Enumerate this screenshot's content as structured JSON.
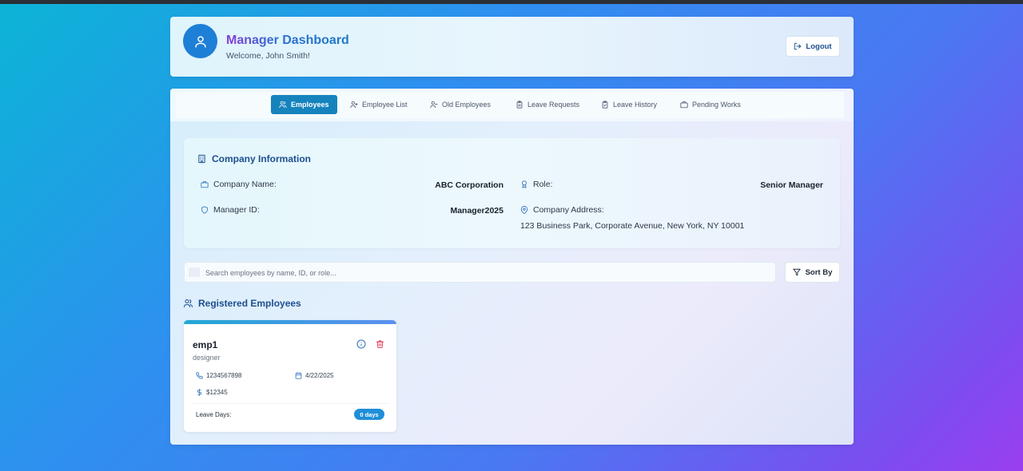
{
  "header": {
    "title": "Manager Dashboard",
    "welcome": "Welcome, John Smith!",
    "logout_label": "Logout"
  },
  "tabs": [
    {
      "label": "Employees",
      "icon": "users-icon",
      "active": true
    },
    {
      "label": "Employee List",
      "icon": "user-plus-icon",
      "active": false
    },
    {
      "label": "Old Employees",
      "icon": "user-minus-icon",
      "active": false
    },
    {
      "label": "Leave Requests",
      "icon": "clipboard-icon",
      "active": false
    },
    {
      "label": "Leave History",
      "icon": "clipboard-check-icon",
      "active": false
    },
    {
      "label": "Pending Works",
      "icon": "briefcase-icon",
      "active": false
    }
  ],
  "company": {
    "title": "Company Information",
    "name_label": "Company Name:",
    "name_value": "ABC Corporation",
    "role_label": "Role:",
    "role_value": "Senior Manager",
    "manager_id_label": "Manager ID:",
    "manager_id_value": "Manager2025",
    "address_label": "Company Address:",
    "address_value": "123 Business Park, Corporate Avenue, New York, NY 10001"
  },
  "search": {
    "placeholder": "Search employees by name, ID, or role...",
    "value": ""
  },
  "sort_label": "Sort By",
  "registered_title": "Registered Employees",
  "employees": [
    {
      "name": "emp1",
      "role": "designer",
      "phone": "1234567898",
      "date": "4/22/2025",
      "salary": "$12345",
      "leave_label": "Leave Days:",
      "leave_value": "0 days"
    }
  ],
  "colors": {
    "accent": "#1683bd",
    "title_blue": "#1d4f8e",
    "delete_red": "#e0314b"
  }
}
